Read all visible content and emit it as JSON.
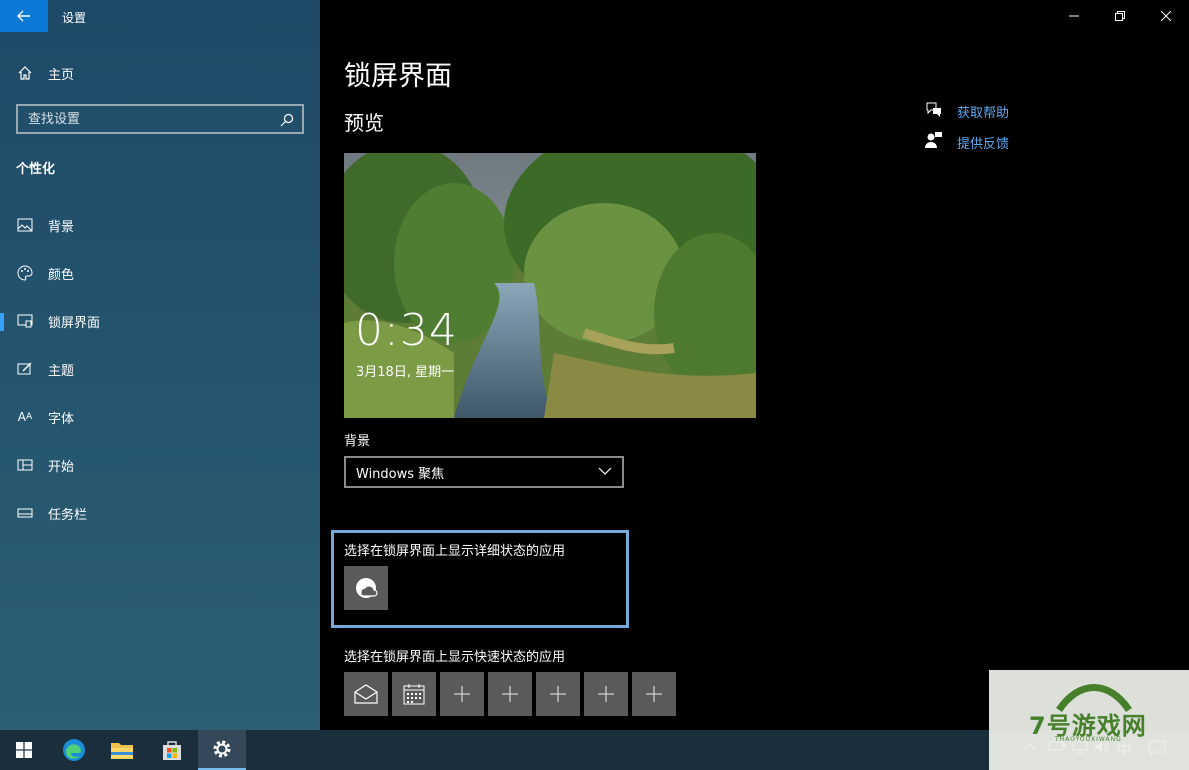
{
  "window": {
    "title": "设置"
  },
  "sidebar": {
    "home_label": "主页",
    "search_placeholder": "查找设置",
    "section_title": "个性化",
    "items": [
      {
        "label": "背景",
        "icon": "picture-icon"
      },
      {
        "label": "颜色",
        "icon": "palette-icon"
      },
      {
        "label": "锁屏界面",
        "icon": "lock-screen-icon",
        "selected": true
      },
      {
        "label": "主题",
        "icon": "theme-icon"
      },
      {
        "label": "字体",
        "icon": "font-icon"
      },
      {
        "label": "开始",
        "icon": "start-icon"
      },
      {
        "label": "任务栏",
        "icon": "taskbar-icon"
      }
    ]
  },
  "main": {
    "title": "锁屏界面",
    "preview_heading": "预览",
    "preview": {
      "time": "0:34",
      "date": "3月18日, 星期一"
    },
    "background_label": "背景",
    "background_value": "Windows 聚焦",
    "detailed_status_label": "选择在锁屏界面上显示详细状态的应用",
    "quick_status_label": "选择在锁屏界面上显示快速状态的应用",
    "help": {
      "get_help": "获取帮助",
      "feedback": "提供反馈"
    }
  },
  "taskbar": {
    "apps": [
      "windows-start-icon",
      "edge-icon",
      "file-explorer-icon",
      "store-icon",
      "settings-icon"
    ],
    "ime": "中"
  },
  "watermark": {
    "text": "7号游戏网",
    "sub": "THAOYOUXIWANG"
  },
  "colors": {
    "accent": "#0a78d4",
    "link": "#5ea8ef",
    "selection": "#74a9d8"
  }
}
